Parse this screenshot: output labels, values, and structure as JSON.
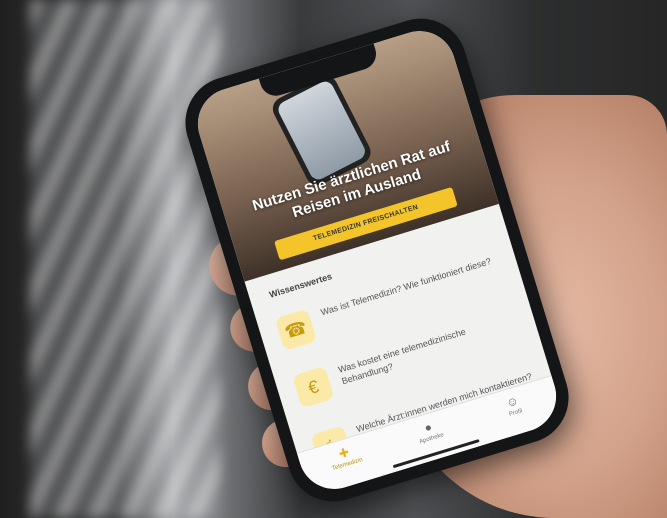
{
  "scene": {
    "hero": {
      "title_line1": "Nutzen Sie ärztlichen Rat auf",
      "title_line2": "Reisen im Ausland",
      "cta_label": "TELEMEDIZIN FREISCHALTEN"
    },
    "section_title": "Wissenswertes",
    "items": [
      {
        "icon": "phone-doctor-icon",
        "label": "Was ist Telemedizin? Wie funktioniert diese?"
      },
      {
        "icon": "euro-hand-icon",
        "label": "Was kostet eine telemedizinische Behandlung?"
      },
      {
        "icon": "doctors-icon",
        "label": "Welche Ärzt:innen werden mich kontaktieren?"
      }
    ],
    "tabs": [
      {
        "icon": "medkit-icon",
        "label": "Telemedizin",
        "active": true
      },
      {
        "icon": "pill-icon",
        "label": "Apotheke",
        "active": false
      },
      {
        "icon": "profile-icon",
        "label": "Profil",
        "active": false
      }
    ],
    "colors": {
      "accent": "#f3c52a"
    }
  }
}
